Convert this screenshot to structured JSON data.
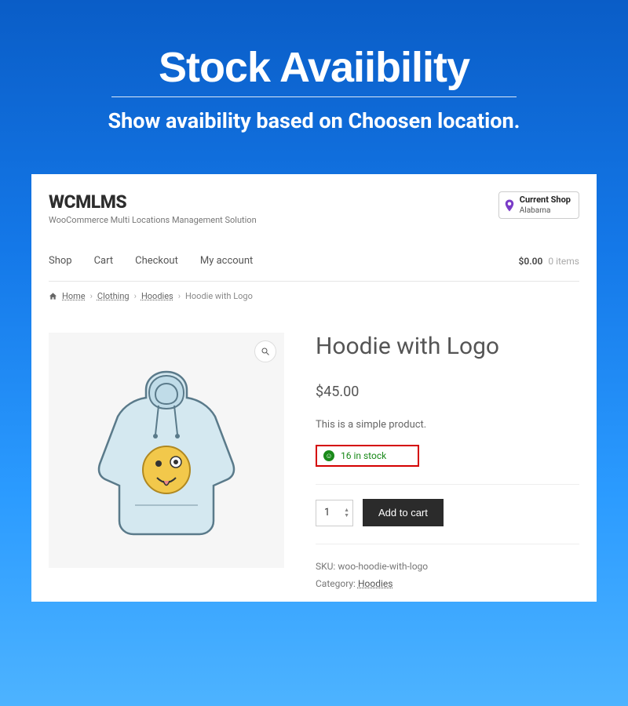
{
  "hero": {
    "title": "Stock Avaiibility",
    "subtitle": "Show avaibility based on Choosen location."
  },
  "header": {
    "brand": "WCMLMS",
    "tagline": "WooCommerce Multi Locations Management Solution",
    "currentShop": {
      "label": "Current Shop",
      "value": "Alabama"
    }
  },
  "nav": {
    "items": [
      "Shop",
      "Cart",
      "Checkout",
      "My account"
    ],
    "cart": {
      "amount": "$0.00",
      "count": "0 items"
    }
  },
  "breadcrumbs": {
    "home": "Home",
    "items": [
      "Clothing",
      "Hoodies"
    ],
    "current": "Hoodie with Logo"
  },
  "product": {
    "title": "Hoodie with Logo",
    "price": "$45.00",
    "description": "This is a simple product.",
    "stock": "16 in stock",
    "qty": "1",
    "addToCart": "Add to cart",
    "skuLabel": "SKU:",
    "sku": "woo-hoodie-with-logo",
    "categoryLabel": "Category:",
    "category": "Hoodies"
  }
}
